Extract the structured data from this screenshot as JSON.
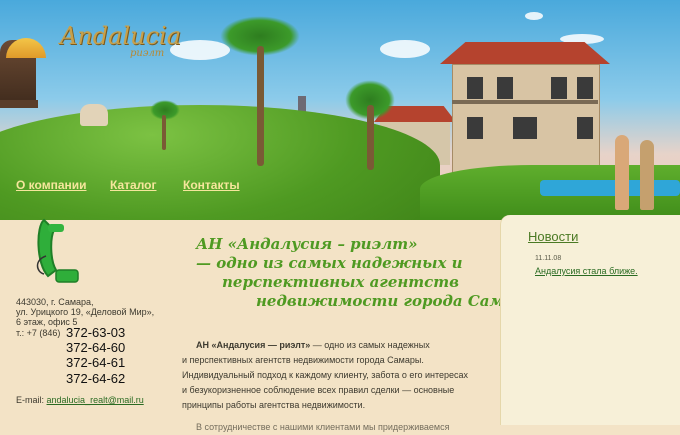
{
  "logo": {
    "name": "Andalucia",
    "sub": "риэлт"
  },
  "nav": {
    "about": "О компании",
    "catalog": "Каталог",
    "contacts": "Контакты"
  },
  "contacts": {
    "address": [
      "443030, г. Самара,",
      "ул. Урицкого 19, «Деловой Мир»,",
      "6 этаж, офис 5"
    ],
    "phone_label": "т.: +7 (846)",
    "phones": [
      "372-63-03",
      "372-64-60",
      "372-64-61",
      "372-64-62"
    ],
    "email_label": "E-mail:",
    "email": "andalucia_realt@mail.ru"
  },
  "slogan": [
    "АН «Андалусия – риэлт»",
    "— одно из самых надежных и",
    "перспективных агентств",
    "недвижимости города Самары."
  ],
  "body": {
    "bold": "АН «Андалусия — риэлт»",
    "rest": " — одно из самых надежных",
    "lines": [
      "и перспективных агентств недвижимости города Самары.",
      "Индивидуальный подход к каждому клиенту, забота о его интересах",
      "и безукоризненное соблюдение всех правил сделки — основные",
      "принципы работы агентства недвижимости.",
      "В сотрудничестве с нашими клиентами мы придерживаемся"
    ]
  },
  "news": {
    "title": "Новости",
    "date": "11.11.08",
    "link": "Андалусия стала ближе."
  },
  "colors": {
    "accent": "#4f9a22",
    "nav_text": "#f5e69c",
    "link": "#2a6b22"
  }
}
